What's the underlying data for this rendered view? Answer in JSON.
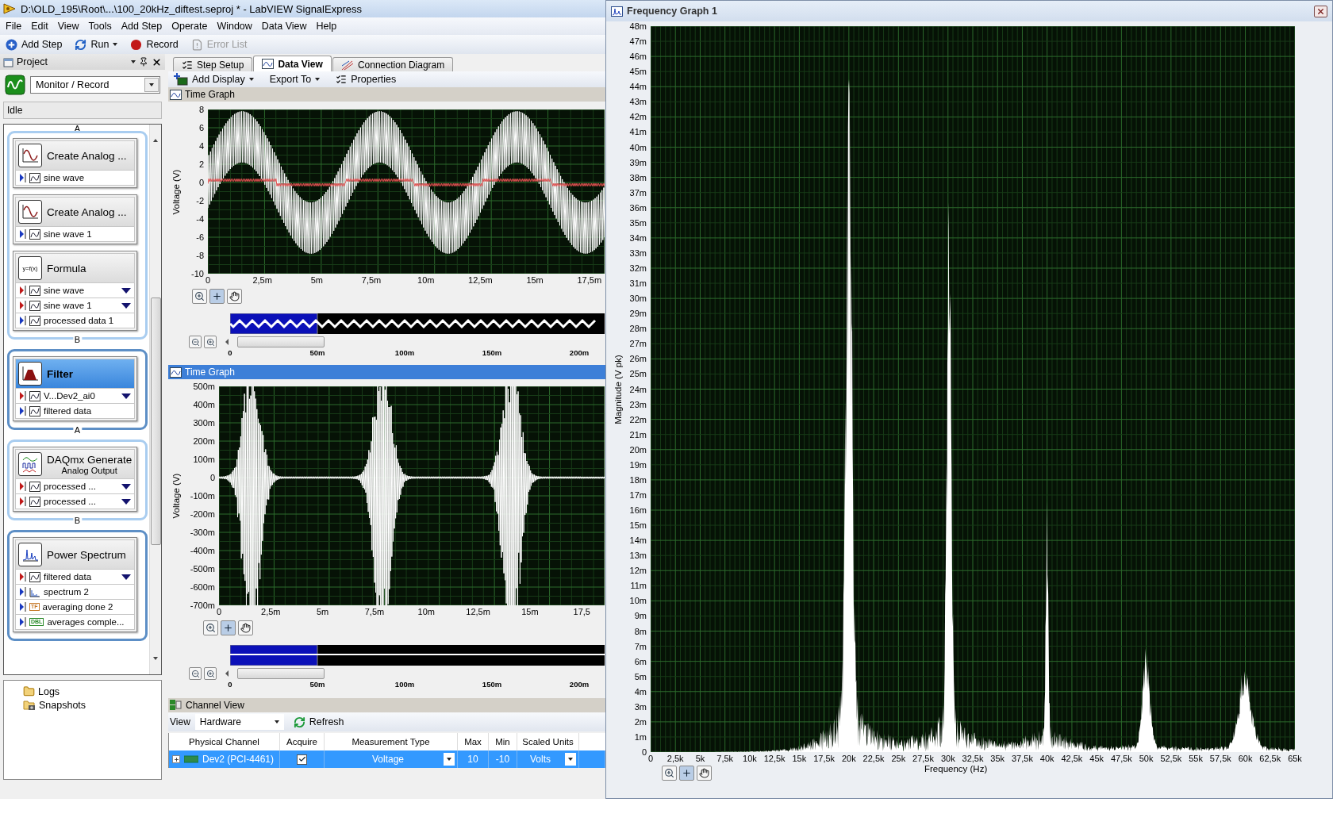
{
  "window": {
    "title": "D:\\OLD_195\\Root\\...\\100_20kHz_diftest.seproj * - LabVIEW SignalExpress"
  },
  "menu": [
    "File",
    "Edit",
    "View",
    "Tools",
    "Add Step",
    "Operate",
    "Window",
    "Data View",
    "Help"
  ],
  "toolbar": [
    {
      "kind": "add",
      "label": "Add Step",
      "disabled": false,
      "dropdown": false
    },
    {
      "kind": "run",
      "label": "Run",
      "disabled": false,
      "dropdown": true
    },
    {
      "kind": "record",
      "label": "Record",
      "disabled": false,
      "dropdown": false
    },
    {
      "kind": "errors",
      "label": "Error List",
      "disabled": true,
      "dropdown": false
    }
  ],
  "project": {
    "title": "Project",
    "mode": "Monitor / Record",
    "status": "Idle",
    "groups": [
      {
        "top_label": "A",
        "bottom_label": "B",
        "steps": [
          {
            "title": "Create Analog ...",
            "kind": "signal",
            "selected": false,
            "rows": [
              {
                "label": "sine wave",
                "input": false,
                "kind": "waveform",
                "dropdown": false
              }
            ]
          },
          {
            "title": "Create Analog ...",
            "kind": "signal",
            "selected": false,
            "rows": [
              {
                "label": "sine wave 1",
                "input": false,
                "kind": "waveform",
                "dropdown": false
              }
            ]
          },
          {
            "title": "Formula",
            "kind": "formula",
            "icon_text": "y=f(x)",
            "selected": false,
            "rows": [
              {
                "label": "sine wave",
                "input": true,
                "kind": "waveform",
                "dropdown": true
              },
              {
                "label": "sine wave 1",
                "input": true,
                "kind": "waveform",
                "dropdown": true
              },
              {
                "label": "processed data 1",
                "input": false,
                "kind": "waveform",
                "dropdown": false
              }
            ]
          }
        ]
      },
      {
        "bottom_label": "A",
        "steps": [
          {
            "title": "Filter",
            "kind": "filter",
            "selected": true,
            "rows": [
              {
                "label": "V...Dev2_ai0",
                "input": true,
                "kind": "waveform",
                "dropdown": true
              },
              {
                "label": "filtered data",
                "input": false,
                "kind": "waveform",
                "dropdown": false
              }
            ]
          }
        ]
      },
      {
        "bottom_label": "B",
        "steps": [
          {
            "title": "DAQmx Generate",
            "subtitle": "Analog Output",
            "kind": "daq",
            "selected": false,
            "rows": [
              {
                "label": "processed ...",
                "input": true,
                "kind": "waveform",
                "dropdown": true
              },
              {
                "label": "processed ...",
                "input": true,
                "kind": "waveform",
                "dropdown": true
              }
            ]
          }
        ]
      },
      {
        "steps": [
          {
            "title": "Power Spectrum",
            "kind": "spectrum",
            "selected": false,
            "rows": [
              {
                "label": "filtered data",
                "input": true,
                "kind": "waveform",
                "dropdown": true
              },
              {
                "label": "spectrum 2",
                "input": false,
                "kind": "spectrum",
                "dropdown": false
              },
              {
                "label": "averaging done 2",
                "input": false,
                "kind": "badge",
                "badge": "TF",
                "dropdown": false
              },
              {
                "label": "averages comple...",
                "input": false,
                "kind": "badge",
                "badge": "DBL",
                "dropdown": false
              }
            ]
          }
        ]
      }
    ],
    "tree": [
      {
        "label": "Logs",
        "kind": "logs"
      },
      {
        "label": "Snapshots",
        "kind": "snapshots"
      }
    ]
  },
  "tabs": [
    {
      "label": "Step Setup",
      "kind": "setup",
      "selected": false
    },
    {
      "label": "Data View",
      "kind": "data",
      "selected": true
    },
    {
      "label": "Connection Diagram",
      "kind": "diagram",
      "selected": false
    }
  ],
  "data_toolbar": [
    {
      "label": "Add Display",
      "kind": "add",
      "dropdown": true
    },
    {
      "label": "Export To",
      "kind": "export",
      "dropdown": true
    },
    {
      "label": "Properties",
      "kind": "properties",
      "dropdown": false
    }
  ],
  "graphs": [
    {
      "title": "Time Graph",
      "selected": false,
      "kind": "multitone",
      "ylabel": "Voltage (V)",
      "yticks": [
        "8",
        "6",
        "4",
        "2",
        "0",
        "-2",
        "-4",
        "-6",
        "-8",
        "-10"
      ],
      "xticks": [
        "0",
        "2,5m",
        "5m",
        "7,5m",
        "10m",
        "12,5m",
        "15m",
        "17,5m"
      ],
      "overview_ticks": [
        "0",
        "50m",
        "100m",
        "150m",
        "200m"
      ]
    },
    {
      "title": "Time Graph",
      "selected": true,
      "kind": "bursts",
      "ylabel": "Voltage (V)",
      "yticks": [
        "500m",
        "400m",
        "300m",
        "200m",
        "100m",
        "0",
        "-100m",
        "-200m",
        "-300m",
        "-400m",
        "-500m",
        "-600m",
        "-700m"
      ],
      "xticks": [
        "0",
        "2,5m",
        "5m",
        "7,5m",
        "10m",
        "12,5m",
        "15m",
        "17,5"
      ],
      "overview_ticks": [
        "0",
        "50m",
        "100m",
        "150m",
        "200m"
      ]
    }
  ],
  "channel_view": {
    "title": "Channel View",
    "view_label": "View",
    "view_value": "Hardware",
    "refresh": "Refresh",
    "columns": [
      "Physical Channel",
      "Acquire",
      "Measurement Type",
      "Max",
      "Min",
      "Scaled Units"
    ],
    "rows": [
      {
        "channel": "Dev2 (PCI-4461)",
        "acquire": true,
        "measurement": "Voltage",
        "max": "10",
        "min": "-10",
        "units": "Volts",
        "selected": true
      }
    ]
  },
  "frequency_window": {
    "title": "Frequency Graph 1",
    "ylabel": "Magnitude (V pk)",
    "xlabel": "Frequency (Hz)",
    "yticks": [
      "48m",
      "47m",
      "46m",
      "45m",
      "44m",
      "43m",
      "42m",
      "41m",
      "40m",
      "39m",
      "38m",
      "37m",
      "36m",
      "35m",
      "34m",
      "33m",
      "32m",
      "31m",
      "30m",
      "29m",
      "28m",
      "27m",
      "26m",
      "25m",
      "24m",
      "23m",
      "22m",
      "21m",
      "20m",
      "19m",
      "18m",
      "17m",
      "16m",
      "15m",
      "14m",
      "13m",
      "12m",
      "11m",
      "10m",
      "9m",
      "8m",
      "7m",
      "6m",
      "5m",
      "4m",
      "3m",
      "2m",
      "1m",
      "0"
    ],
    "xticks": [
      "0",
      "2,5k",
      "5k",
      "7,5k",
      "10k",
      "12,5k",
      "15k",
      "17,5k",
      "20k",
      "22,5k",
      "25k",
      "27,5k",
      "30k",
      "32,5k",
      "35k",
      "37,5k",
      "40k",
      "42,5k",
      "45k",
      "47,5k",
      "50k",
      "52,5k",
      "55k",
      "57,5k",
      "60k",
      "62,5k",
      "65k"
    ]
  }
}
